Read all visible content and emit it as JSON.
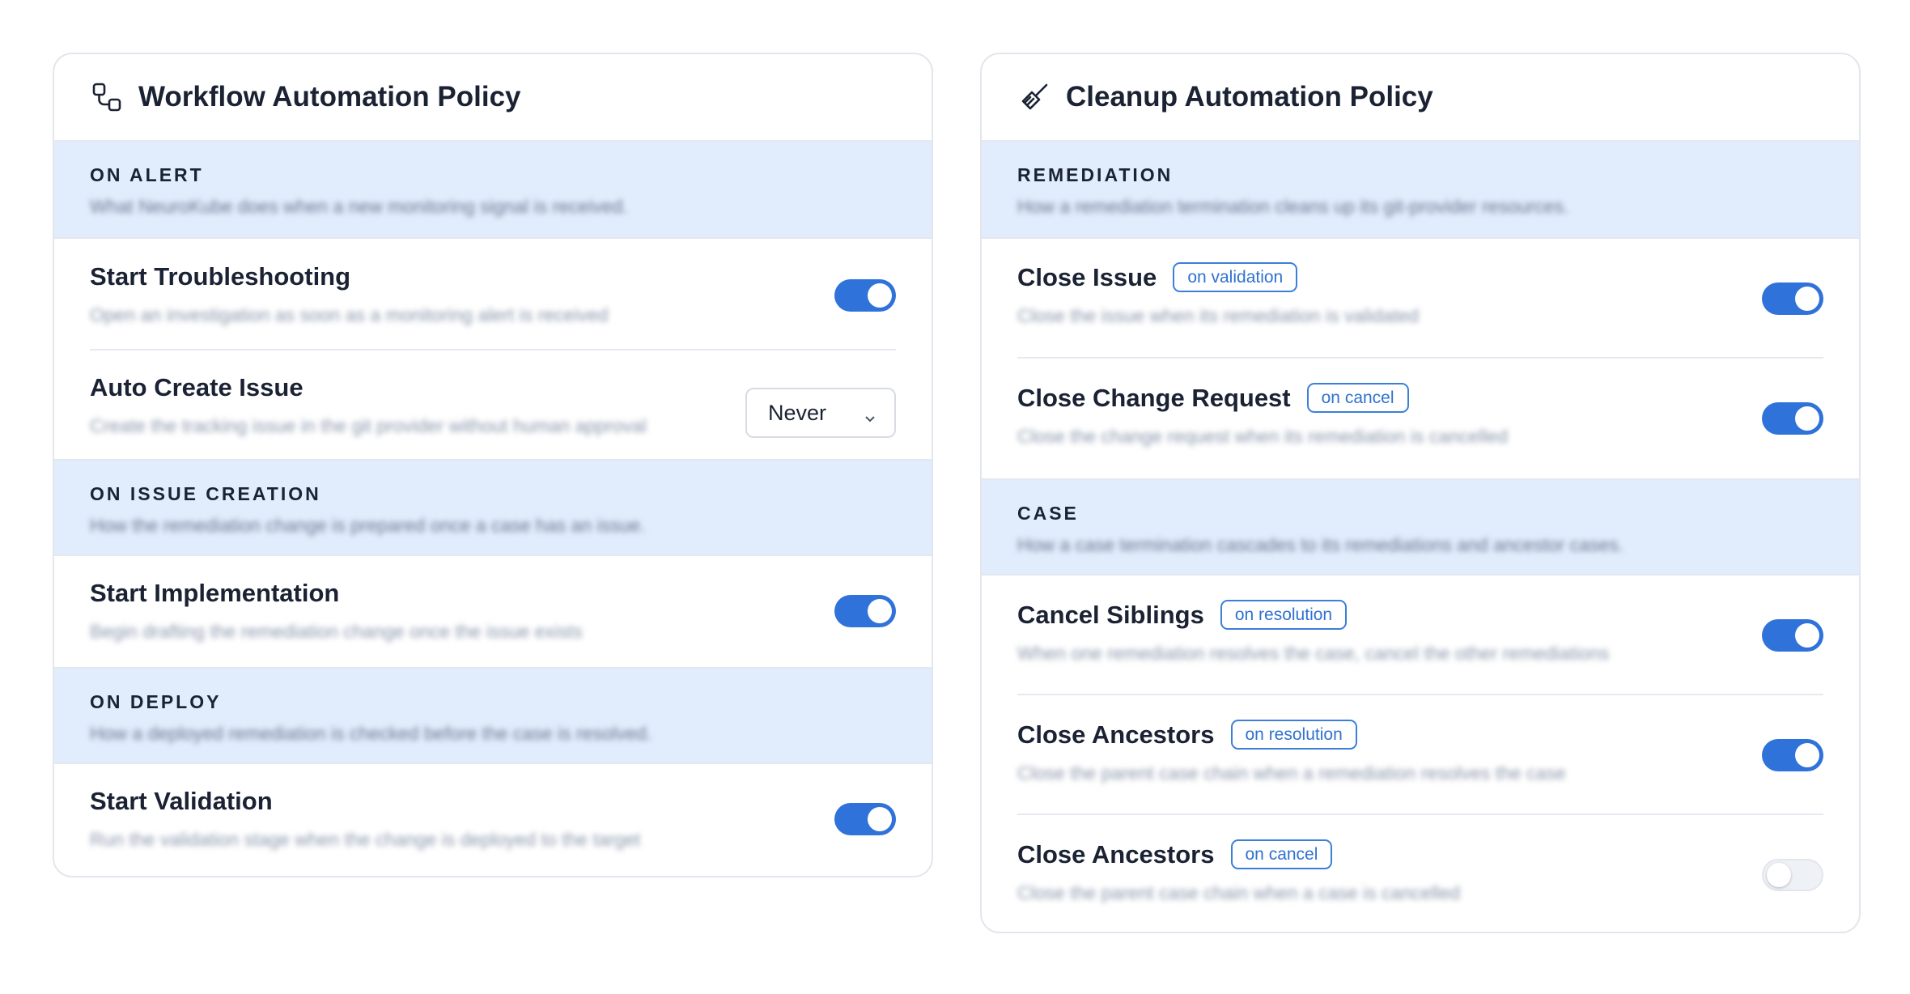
{
  "workflow_policy": {
    "title": "Workflow Automation Policy",
    "icon": "workflow-icon",
    "sections": [
      {
        "title": "ON ALERT",
        "description": "What NeuroKube does when a new monitoring signal is received.",
        "items": [
          {
            "title": "Start Troubleshooting",
            "description": "Open an investigation as soon as a monitoring alert is received",
            "control": "toggle",
            "enabled": true
          },
          {
            "title": "Auto Create Issue",
            "description": "Create the tracking issue in the git provider without human approval",
            "control": "select",
            "value": "Never"
          }
        ]
      },
      {
        "title": "ON ISSUE CREATION",
        "description": "How the remediation change is prepared once a case has an issue.",
        "items": [
          {
            "title": "Start Implementation",
            "description": "Begin drafting the remediation change once the issue exists",
            "control": "toggle",
            "enabled": true
          }
        ]
      },
      {
        "title": "ON DEPLOY",
        "description": "How a deployed remediation is checked before the case is resolved.",
        "items": [
          {
            "title": "Start Validation",
            "description": "Run the validation stage when the change is deployed to the target",
            "control": "toggle",
            "enabled": true
          }
        ]
      }
    ]
  },
  "cleanup_policy": {
    "title": "Cleanup Automation Policy",
    "icon": "broom-icon",
    "sections": [
      {
        "title": "REMEDIATION",
        "description": "How a remediation termination cleans up its git-provider resources.",
        "items": [
          {
            "title": "Close Issue",
            "badge": "on validation",
            "description": "Close the issue when its remediation is validated",
            "enabled": true
          },
          {
            "title": "Close Change Request",
            "badge": "on cancel",
            "description": "Close the change request when its remediation is cancelled",
            "enabled": true
          }
        ]
      },
      {
        "title": "CASE",
        "description": "How a case termination cascades to its remediations and ancestor cases.",
        "items": [
          {
            "title": "Cancel Siblings",
            "badge": "on resolution",
            "description": "When one remediation resolves the case, cancel the other remediations",
            "enabled": true
          },
          {
            "title": "Close Ancestors",
            "badge": "on resolution",
            "description": "Close the parent case chain when a remediation resolves the case",
            "enabled": true
          },
          {
            "title": "Close Ancestors",
            "badge": "on cancel",
            "description": "Close the parent case chain when a case is cancelled",
            "enabled": false
          }
        ]
      }
    ]
  },
  "colors": {
    "accent": "#2f72d9",
    "section_background": "#e1edfc",
    "border": "#e3e6ec"
  }
}
